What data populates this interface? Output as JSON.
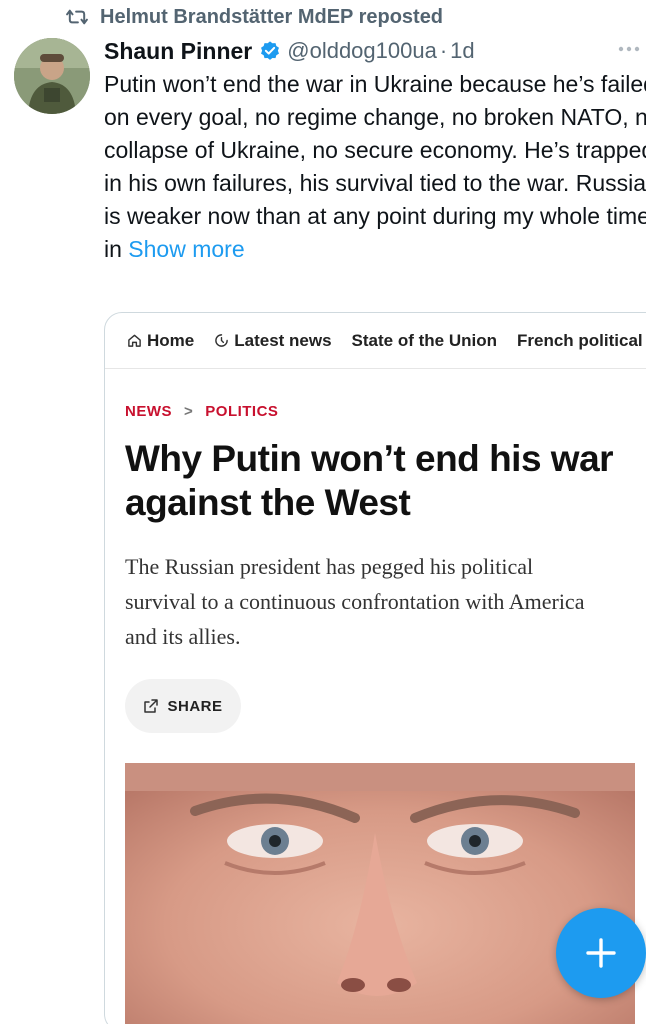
{
  "repost": {
    "icon": "repost-icon",
    "text": "Helmut Brandstätter MdEP reposted"
  },
  "tweet": {
    "author_name": "Shaun Pinner",
    "verified_icon": "verified-badge-icon",
    "handle": "@olddog100ua",
    "separator": "·",
    "time": "1d",
    "more_icon": "more-options-icon",
    "body": "Putin won’t end the war in Ukraine because he’s failed on every goal, no regime change, no broken NATO, no collapse of Ukraine, no secure economy. He’s trapped in his own failures, his survival tied to the war. Russia is weaker now than at any point during my whole time in ",
    "show_more": "Show more"
  },
  "card": {
    "nav": [
      {
        "icon": "home-icon",
        "label": "Home"
      },
      {
        "icon": "clock-icon",
        "label": "Latest news"
      },
      {
        "icon": "",
        "label": "State of the Union"
      },
      {
        "icon": "",
        "label": "French political"
      }
    ],
    "breadcrumb": {
      "first": "NEWS",
      "separator": ">",
      "second": "POLITICS"
    },
    "headline": "Why Putin won’t end his war against the West",
    "subhead": "The Russian president has pegged his political survival to a continuous confrontation with America and its allies.",
    "share_label": "SHARE",
    "share_icon": "share-icon"
  },
  "fab": {
    "icon": "plus-icon"
  },
  "colors": {
    "accent": "#1d9bf0",
    "breadcrumb_red": "#c8102e",
    "secondary_text": "#536471"
  }
}
